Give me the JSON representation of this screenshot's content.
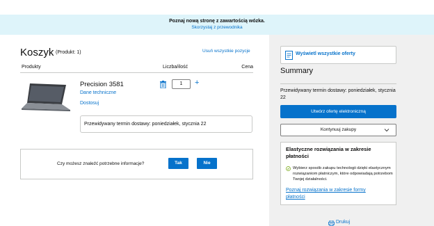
{
  "banner": {
    "title": "Poznaj nową stronę z zawartością wózka.",
    "link": "Skorzystaj z przewodnika"
  },
  "cart": {
    "title": "Koszyk",
    "count": "(Produkt: 1)",
    "remove_all": "Usuń wszystkie pozycje",
    "columns": {
      "products": "Produkty",
      "qty": "Liczba/ilość",
      "price": "Cena"
    },
    "item": {
      "name": "Precision 3581",
      "tech_link": "Dane techniczne",
      "customize_link": "Dostosuj",
      "quantity": "1",
      "delivery": "Przewidywany termin dostawy: poniedziałek, stycznia 22"
    }
  },
  "feedback": {
    "question": "Czy możesz znaleźć potrzebne informacje?",
    "yes": "Tak",
    "no": "Nie"
  },
  "summary": {
    "offers_button": "Wyświetl wszystkie oferty",
    "title": "Summary",
    "delivery": "Przewidywany termin dostawy: poniedziałek, stycznia 22",
    "create_offer": "Utwórz ofertę elektroniczną",
    "continue": "Kontynuuj zakupy",
    "financing": {
      "title": "Elastyczne rozwiązania w zakresie płatności",
      "text": "Wybierz sposób zakupu technologii dzięki elastycznym rozwiązaniom płatniczym, które odpowiadają potrzebom Twojej działalności.",
      "link": "Poznaj rozwiązania w zakresie formy płatności"
    },
    "print": "Drukuj"
  },
  "colors": {
    "accent": "#0672cb",
    "banner_bg": "#def4fa",
    "summary_bg": "#f0f0f0"
  }
}
